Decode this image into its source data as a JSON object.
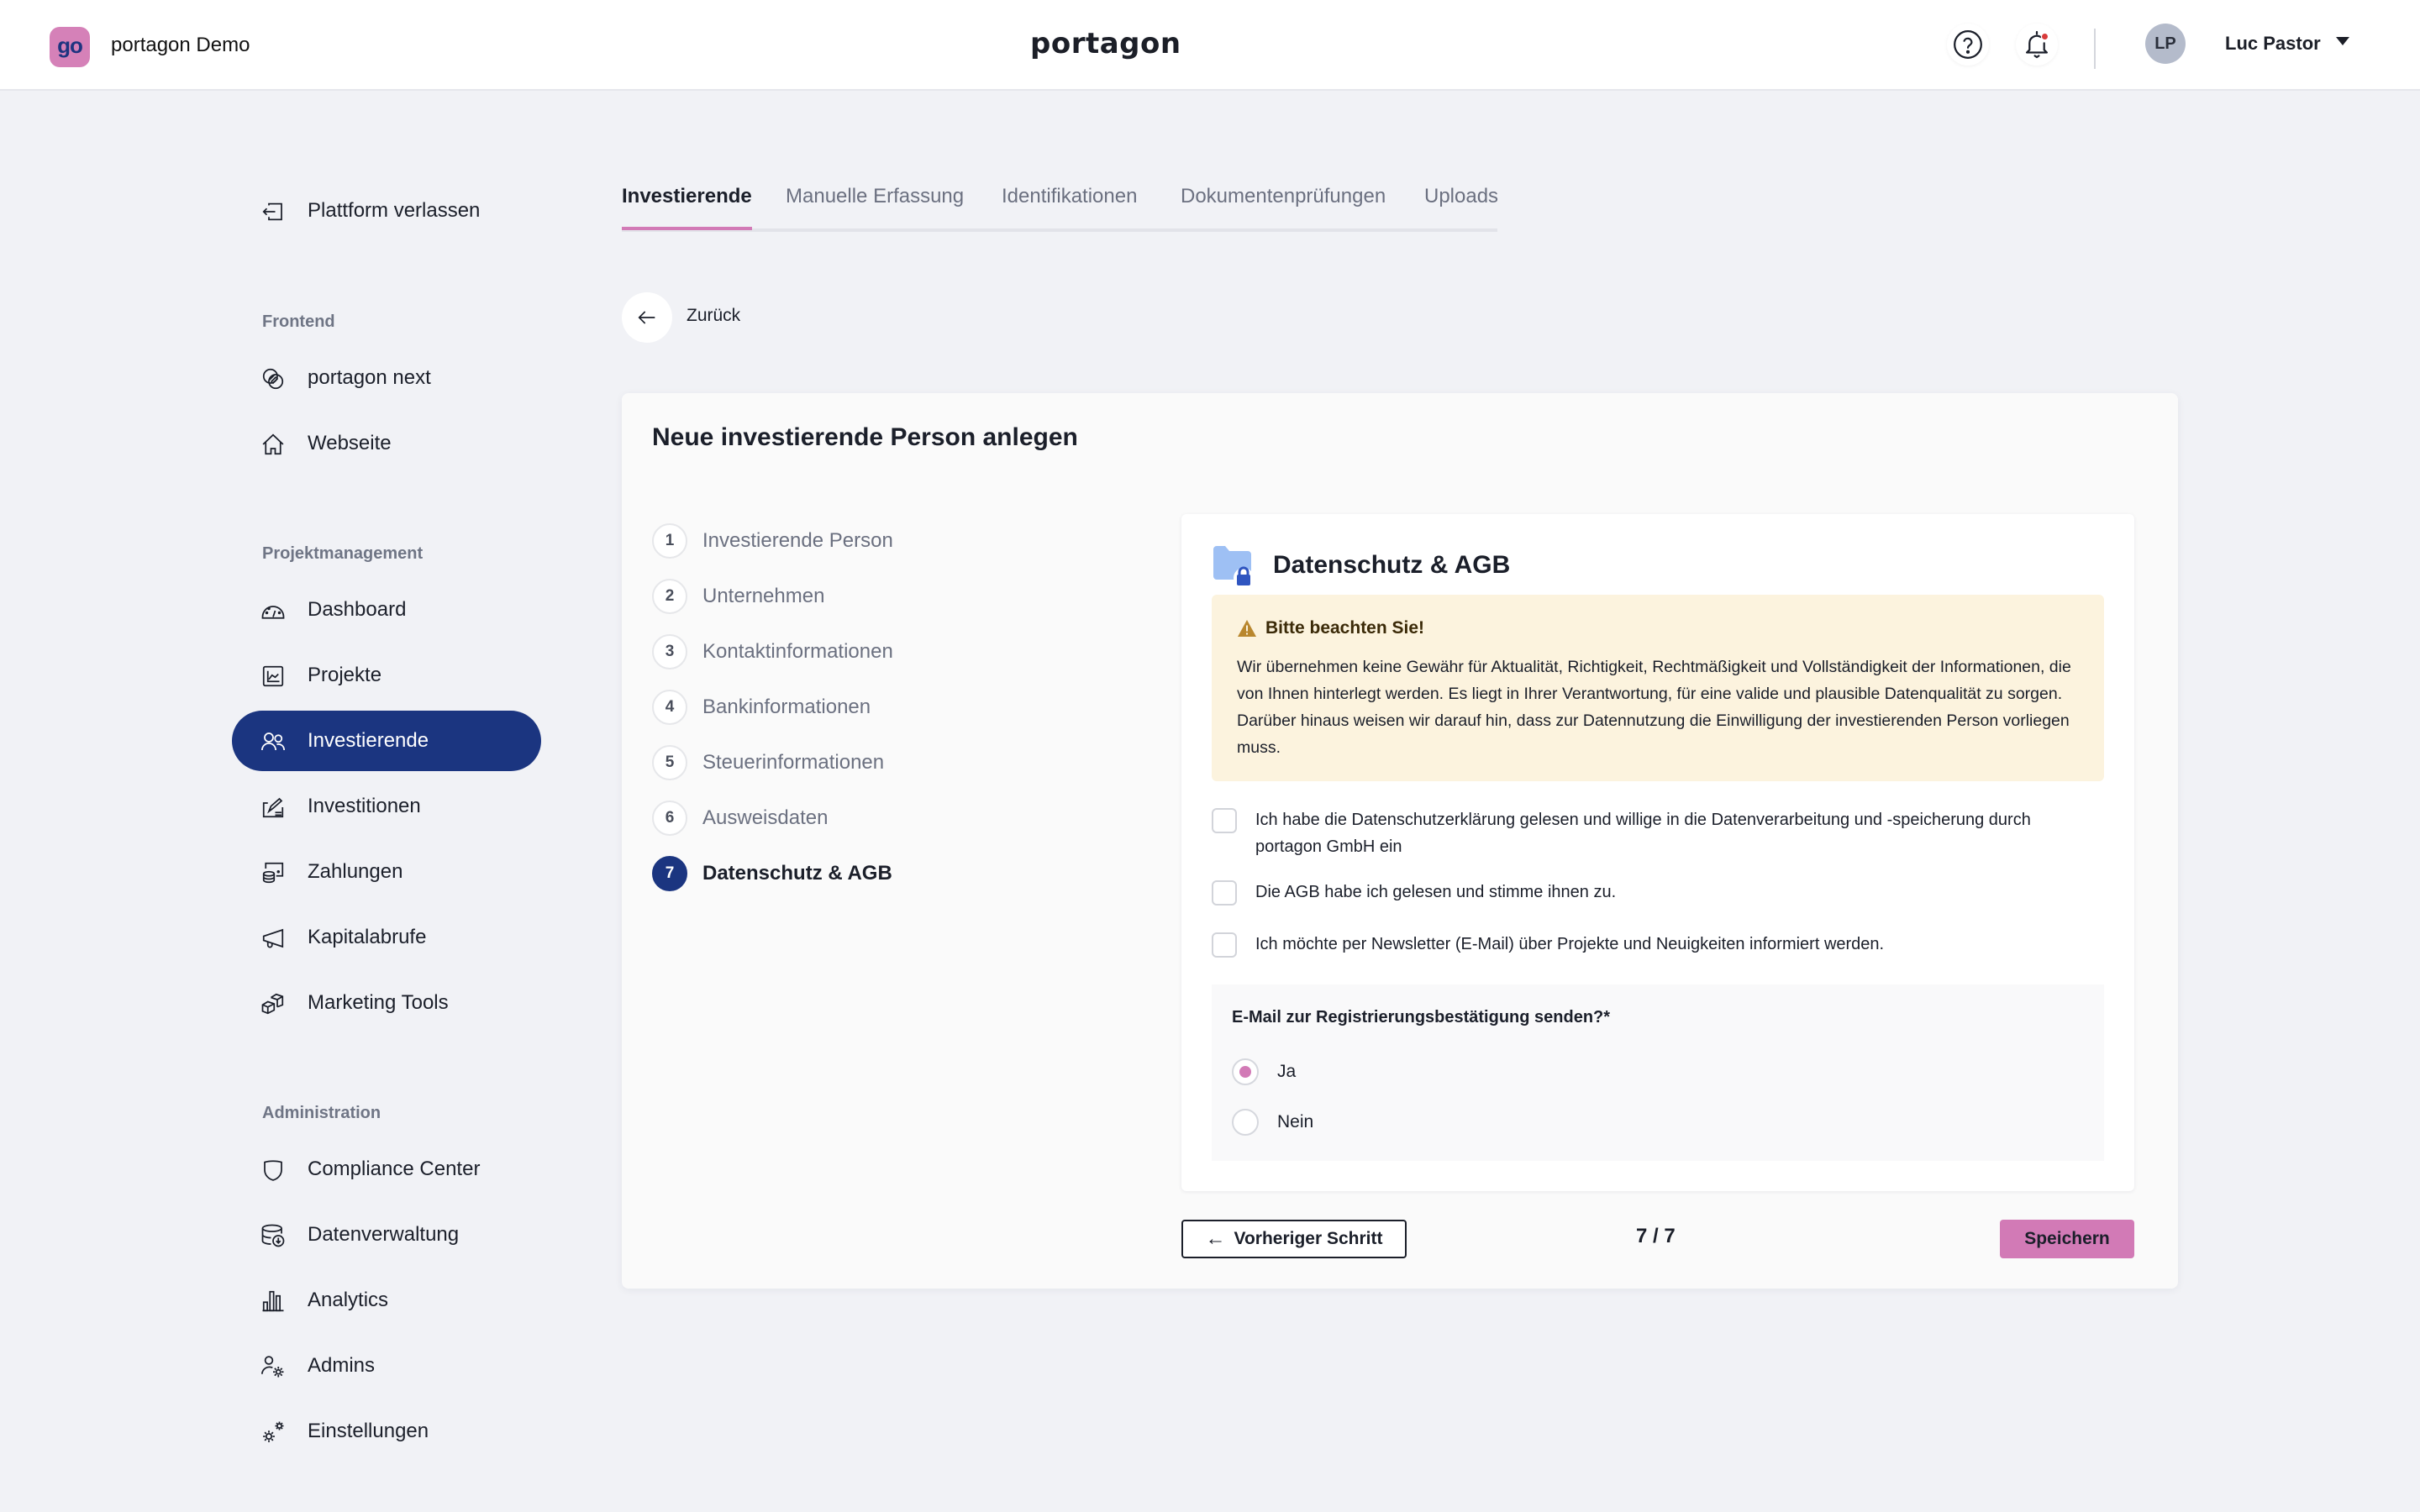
{
  "header": {
    "app_logo_text": "go",
    "app_name": "portagon Demo",
    "brand": "portagon",
    "help_icon": "help-circle-icon",
    "bell_icon": "bell-icon",
    "notification_dot_color": "#d83a3a",
    "avatar_initials": "LP",
    "user_name": "Luc Pastor"
  },
  "sidebar": {
    "exit": {
      "label": "Plattform verlassen",
      "icon": "exit-icon"
    },
    "sections": [
      {
        "title": "Frontend",
        "items": [
          {
            "label": "portagon next",
            "icon": "portagon-next-icon"
          },
          {
            "label": "Webseite",
            "icon": "home-icon"
          }
        ]
      },
      {
        "title": "Projektmanagement",
        "items": [
          {
            "label": "Dashboard",
            "icon": "gauge-icon"
          },
          {
            "label": "Projekte",
            "icon": "chart-line-icon"
          },
          {
            "label": "Investierende",
            "icon": "users-icon",
            "active": true
          },
          {
            "label": "Investitionen",
            "icon": "signature-icon"
          },
          {
            "label": "Zahlungen",
            "icon": "coins-icon"
          },
          {
            "label": "Kapitalabrufe",
            "icon": "megaphone-icon"
          },
          {
            "label": "Marketing Tools",
            "icon": "boxes-icon"
          }
        ]
      },
      {
        "title": "Administration",
        "items": [
          {
            "label": "Compliance Center",
            "icon": "shield-icon"
          },
          {
            "label": "Datenverwaltung",
            "icon": "database-download-icon"
          },
          {
            "label": "Analytics",
            "icon": "bar-chart-icon"
          },
          {
            "label": "Admins",
            "icon": "user-gear-icon"
          },
          {
            "label": "Einstellungen",
            "icon": "gears-icon"
          }
        ]
      }
    ]
  },
  "tabs": [
    {
      "label": "Investierende",
      "active": true
    },
    {
      "label": "Manuelle Erfassung"
    },
    {
      "label": "Identifikationen"
    },
    {
      "label": "Dokumentenprüfungen"
    },
    {
      "label": "Uploads"
    }
  ],
  "back": {
    "label": "Zurück"
  },
  "card": {
    "title": "Neue investierende Person anlegen",
    "steps": [
      {
        "num": "1",
        "label": "Investierende Person"
      },
      {
        "num": "2",
        "label": "Unternehmen"
      },
      {
        "num": "3",
        "label": "Kontaktinformationen"
      },
      {
        "num": "4",
        "label": "Bankinformationen"
      },
      {
        "num": "5",
        "label": "Steuerinformationen"
      },
      {
        "num": "6",
        "label": "Ausweisdaten"
      },
      {
        "num": "7",
        "label": "Datenschutz & AGB",
        "active": true
      }
    ],
    "panel": {
      "title": "Datenschutz & AGB",
      "notice": {
        "title": "Bitte beachten Sie!",
        "text": "Wir übernehmen keine Gewähr für Aktualität, Richtigkeit, Rechtmäßigkeit und Vollständigkeit der Informationen, die von Ihnen hinterlegt werden. Es liegt in Ihrer Verantwortung, für eine valide und plausible Datenqualität zu sorgen. Darüber hinaus weisen wir darauf hin, dass zur Datennutzung die Einwilligung der investierenden Person vorliegen muss."
      },
      "checkboxes": [
        {
          "label": "Ich habe die Datenschutzerklärung gelesen und willige in die Datenverarbeitung und -speicherung durch portagon GmbH ein",
          "checked": false
        },
        {
          "label": "Die AGB habe ich gelesen und stimme ihnen zu.",
          "checked": false
        },
        {
          "label": "Ich möchte per Newsletter (E-Mail) über Projekte und Neuigkeiten informiert werden.",
          "checked": false
        }
      ],
      "radio_question": "E-Mail zur Registrierungsbestätigung senden?*",
      "radio_options": [
        {
          "label": "Ja",
          "selected": true
        },
        {
          "label": "Nein",
          "selected": false
        }
      ]
    },
    "footer": {
      "prev_label": "Vorheriger Schritt",
      "page_count": "7 / 7",
      "save_label": "Speichern"
    }
  },
  "colors": {
    "primary": "#1b3580",
    "accent": "#d27ab6",
    "notice_bg": "#fcf3de",
    "background": "#f1f2f6"
  }
}
